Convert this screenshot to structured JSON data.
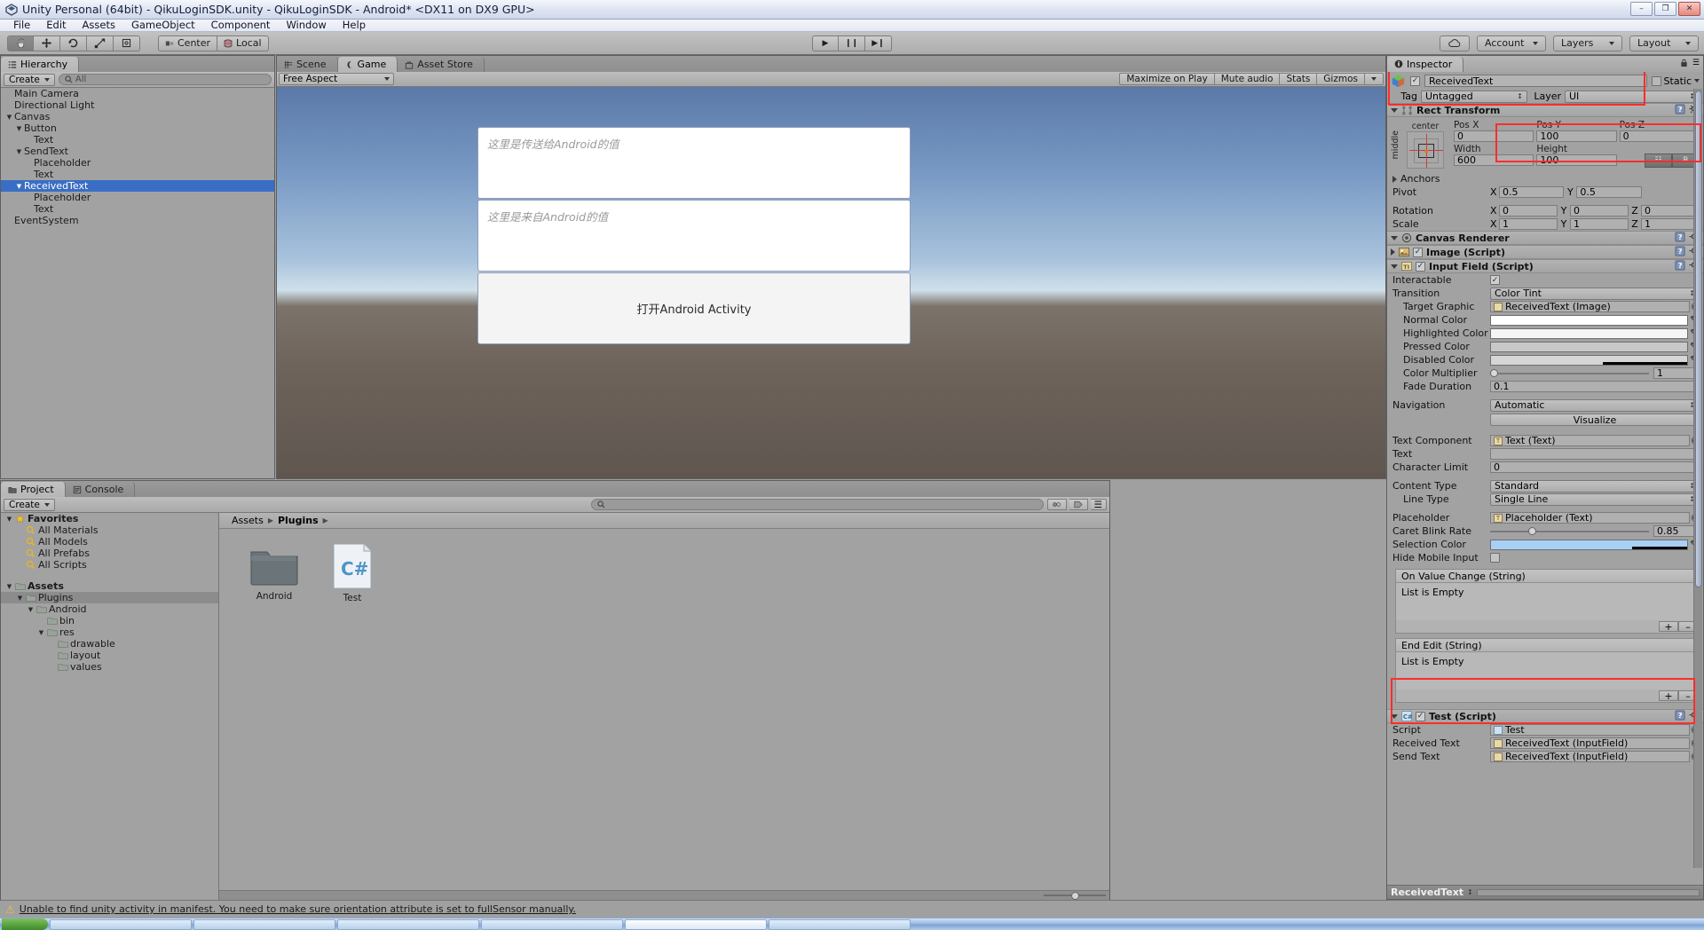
{
  "window": {
    "title": "Unity Personal (64bit) - QikuLoginSDK.unity - QikuLoginSDK - Android* <DX11 on DX9 GPU>",
    "minimize": "–",
    "maximize": "❐",
    "close": "✕"
  },
  "menu": [
    "File",
    "Edit",
    "Assets",
    "GameObject",
    "Component",
    "Window",
    "Help"
  ],
  "toolbar": {
    "tools": [
      "hand-tool",
      "move-tool",
      "rotate-tool",
      "scale-tool",
      "rect-tool"
    ],
    "pivot_mode": "Center",
    "pivot_space": "Local",
    "play": "▶",
    "pause": "❙❙",
    "step": "▶❙",
    "cloud": "cloud-icon",
    "account": "Account",
    "layers": "Layers",
    "layout": "Layout"
  },
  "hierarchy": {
    "tab": "Hierarchy",
    "create": "Create",
    "search_placeholder": "All",
    "items": [
      {
        "label": "Main Camera",
        "depth": 0,
        "arrow": "",
        "selected": false
      },
      {
        "label": "Directional Light",
        "depth": 0,
        "arrow": "",
        "selected": false
      },
      {
        "label": "Canvas",
        "depth": 0,
        "arrow": "▼",
        "selected": false
      },
      {
        "label": "Button",
        "depth": 1,
        "arrow": "▼",
        "selected": false
      },
      {
        "label": "Text",
        "depth": 2,
        "arrow": "",
        "selected": false
      },
      {
        "label": "SendText",
        "depth": 1,
        "arrow": "▼",
        "selected": false
      },
      {
        "label": "Placeholder",
        "depth": 2,
        "arrow": "",
        "selected": false
      },
      {
        "label": "Text",
        "depth": 2,
        "arrow": "",
        "selected": false
      },
      {
        "label": "ReceivedText",
        "depth": 1,
        "arrow": "▼",
        "selected": true
      },
      {
        "label": "Placeholder",
        "depth": 2,
        "arrow": "",
        "selected": false
      },
      {
        "label": "Text",
        "depth": 2,
        "arrow": "",
        "selected": false
      },
      {
        "label": "EventSystem",
        "depth": 0,
        "arrow": "",
        "selected": false
      }
    ]
  },
  "gameview": {
    "tabs": [
      {
        "label": "Scene",
        "active": false
      },
      {
        "label": "Game",
        "active": true
      },
      {
        "label": "Asset Store",
        "active": false
      }
    ],
    "aspect": "Free Aspect",
    "buttons": [
      "Maximize on Play",
      "Mute audio",
      "Stats",
      "Gizmos"
    ],
    "ui": {
      "send_placeholder": "这里是传送给Android的值",
      "received_placeholder": "这里是来自Android的值",
      "button_label": "打开Android Activity"
    }
  },
  "project": {
    "tabs": [
      {
        "label": "Project",
        "active": true
      },
      {
        "label": "Console",
        "active": false
      }
    ],
    "create": "Create",
    "tree": [
      {
        "label": "Favorites",
        "depth": 0,
        "arrow": "▼",
        "icon": "star-icon",
        "bold": true
      },
      {
        "label": "All Materials",
        "depth": 1,
        "arrow": "",
        "icon": "search-icon",
        "bold": false
      },
      {
        "label": "All Models",
        "depth": 1,
        "arrow": "",
        "icon": "search-icon",
        "bold": false
      },
      {
        "label": "All Prefabs",
        "depth": 1,
        "arrow": "",
        "icon": "search-icon",
        "bold": false
      },
      {
        "label": "All Scripts",
        "depth": 1,
        "arrow": "",
        "icon": "search-icon",
        "bold": false
      },
      {
        "label": "",
        "depth": 0,
        "arrow": "",
        "icon": "",
        "bold": false
      },
      {
        "label": "Assets",
        "depth": 0,
        "arrow": "▼",
        "icon": "folder-icon",
        "bold": true
      },
      {
        "label": "Plugins",
        "depth": 1,
        "arrow": "▼",
        "icon": "folder-icon",
        "bold": false,
        "selected": true
      },
      {
        "label": "Android",
        "depth": 2,
        "arrow": "▼",
        "icon": "folder-icon",
        "bold": false
      },
      {
        "label": "bin",
        "depth": 3,
        "arrow": "",
        "icon": "folder-icon",
        "bold": false
      },
      {
        "label": "res",
        "depth": 3,
        "arrow": "▼",
        "icon": "folder-icon",
        "bold": false
      },
      {
        "label": "drawable",
        "depth": 4,
        "arrow": "",
        "icon": "folder-icon",
        "bold": false
      },
      {
        "label": "layout",
        "depth": 4,
        "arrow": "",
        "icon": "folder-icon",
        "bold": false
      },
      {
        "label": "values",
        "depth": 4,
        "arrow": "",
        "icon": "folder-icon",
        "bold": false
      }
    ],
    "breadcrumb": [
      "Assets",
      "Plugins"
    ],
    "assets": [
      {
        "label": "Android",
        "kind": "folder"
      },
      {
        "label": "Test",
        "kind": "csharp"
      }
    ]
  },
  "inspector": {
    "tab": "Inspector",
    "object_name": "ReceivedText",
    "static_label": "Static",
    "tag_label": "Tag",
    "tag_value": "Untagged",
    "layer_label": "Layer",
    "layer_value": "UI",
    "rect_transform": {
      "title": "Rect Transform",
      "anchor_h": "center",
      "anchor_v": "middle",
      "pos_x_label": "Pos X",
      "pos_x": "0",
      "pos_y_label": "Pos Y",
      "pos_y": "100",
      "pos_z_label": "Pos Z",
      "pos_z": "0",
      "width_label": "Width",
      "width": "600",
      "height_label": "Height",
      "height": "100",
      "blueprint": "R",
      "anchors_label": "Anchors",
      "pivot_label": "Pivot",
      "pivot_x": "0.5",
      "pivot_y": "0.5",
      "rotation_label": "Rotation",
      "rot_x": "0",
      "rot_y": "0",
      "rot_z": "0",
      "scale_label": "Scale",
      "scale_x": "1",
      "scale_y": "1",
      "scale_z": "1"
    },
    "canvas_renderer": {
      "title": "Canvas Renderer"
    },
    "image_script": {
      "title": "Image (Script)"
    },
    "input_field": {
      "title": "Input Field (Script)",
      "interactable_label": "Interactable",
      "transition_label": "Transition",
      "transition_value": "Color Tint",
      "target_graphic_label": "Target Graphic",
      "target_graphic_value": "ReceivedText (Image)",
      "normal_color_label": "Normal Color",
      "highlighted_color_label": "Highlighted Color",
      "pressed_color_label": "Pressed Color",
      "disabled_color_label": "Disabled Color",
      "color_multiplier_label": "Color Multiplier",
      "color_multiplier": "1",
      "fade_duration_label": "Fade Duration",
      "fade_duration": "0.1",
      "navigation_label": "Navigation",
      "navigation_value": "Automatic",
      "visualize": "Visualize",
      "text_component_label": "Text Component",
      "text_component_value": "Text (Text)",
      "text_label": "Text",
      "text_value": "",
      "character_limit_label": "Character Limit",
      "character_limit": "0",
      "content_type_label": "Content Type",
      "content_type_value": "Standard",
      "line_type_label": "Line Type",
      "line_type_value": "Single Line",
      "placeholder_label": "Placeholder",
      "placeholder_value": "Placeholder (Text)",
      "caret_blink_label": "Caret Blink Rate",
      "caret_blink": "0.85",
      "selection_color_label": "Selection Color",
      "hide_mobile_label": "Hide Mobile Input",
      "on_value_change_title": "On Value Change (String)",
      "on_value_change_body": "List is Empty",
      "end_edit_title": "End Edit (String)",
      "end_edit_body": "List is Empty",
      "plus": "+",
      "minus": "–"
    },
    "test_script": {
      "title": "Test (Script)",
      "script_label": "Script",
      "script_value": "Test",
      "received_text_label": "Received Text",
      "received_text_value": "ReceivedText (InputField)",
      "send_text_label": "Send Text",
      "send_text_value": "ReceivedText (InputField)"
    },
    "footer_name": "ReceivedText"
  },
  "statusbar": {
    "message": "Unable to find unity activity in manifest. You need to make sure orientation attribute is set to fullSensor manually."
  },
  "colors": {
    "selection_blue": "#3a6ec4",
    "highlight_red": "#ff2d2d",
    "panel_gray": "#a2a2a2",
    "selection_color_swatch": "#a8d0f5"
  }
}
